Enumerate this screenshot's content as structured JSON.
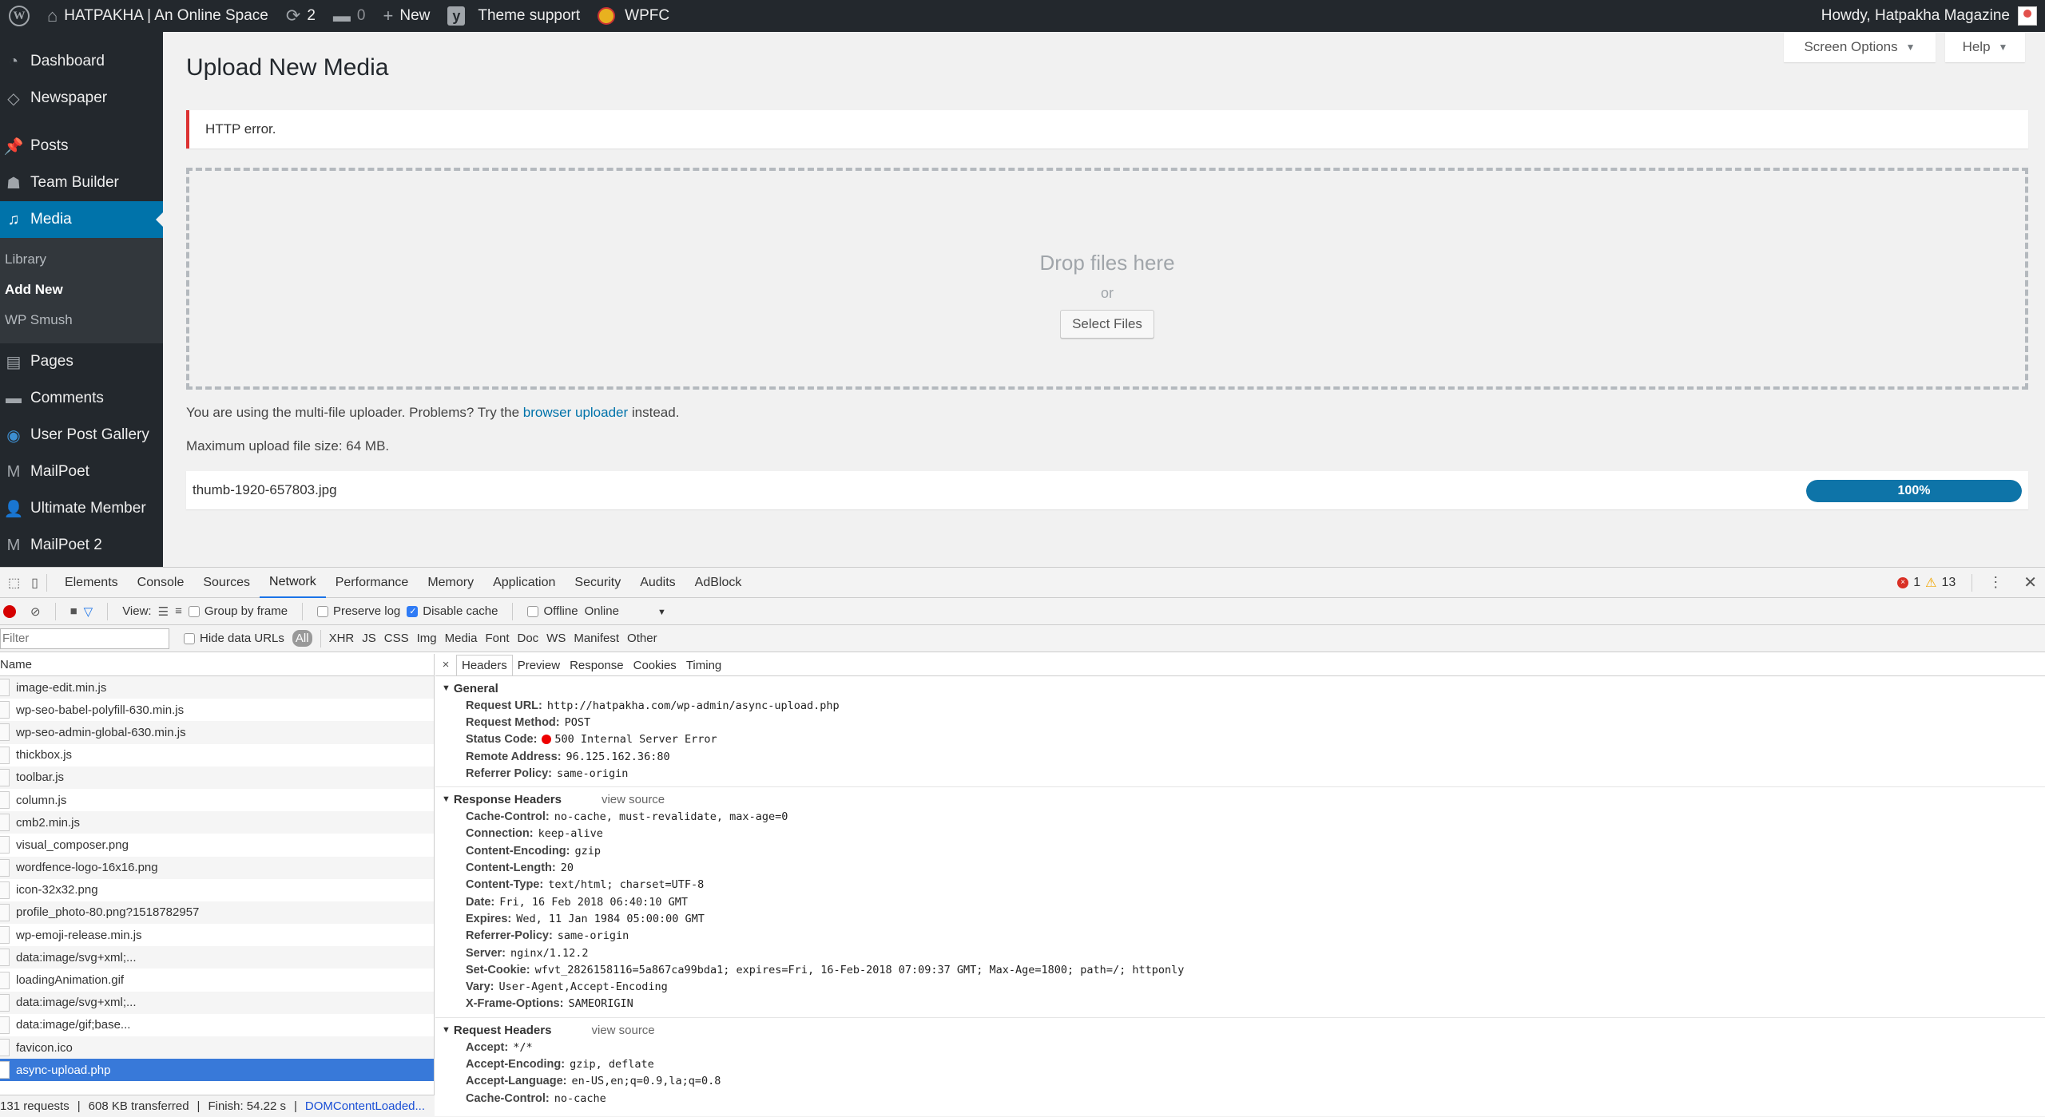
{
  "adminbar": {
    "site_name": "HATPAKHA | An Online Space",
    "updates_count": "2",
    "comments_count": "0",
    "new_label": "New",
    "theme_support": "Theme support",
    "wpfc": "WPFC",
    "howdy": "Howdy, Hatpakha Magazine"
  },
  "sidebar": {
    "items": [
      {
        "label": "Dashboard",
        "icon": "dashboard-icon"
      },
      {
        "label": "Newspaper",
        "icon": "newspaper-icon"
      },
      {
        "label": "Posts",
        "icon": "pin-icon"
      },
      {
        "label": "Team Builder",
        "icon": "team-icon"
      },
      {
        "label": "Media",
        "icon": "media-icon"
      },
      {
        "label": "Pages",
        "icon": "pages-icon"
      },
      {
        "label": "Comments",
        "icon": "comment-icon"
      },
      {
        "label": "User Post Gallery",
        "icon": "camera-icon"
      },
      {
        "label": "MailPoet",
        "icon": "mailpoet-icon"
      },
      {
        "label": "Ultimate Member",
        "icon": "user-icon"
      },
      {
        "label": "MailPoet 2",
        "icon": "mailpoet-icon"
      }
    ],
    "media_submenu": [
      "Library",
      "Add New",
      "WP Smush"
    ]
  },
  "main": {
    "title": "Upload New Media",
    "screen_options": "Screen Options",
    "help": "Help",
    "error_notice": "HTTP error.",
    "drop_title": "Drop files here",
    "drop_or": "or",
    "select_files": "Select Files",
    "uploader_text_pre": "You are using the multi-file uploader. Problems? Try the",
    "uploader_link": "browser uploader",
    "uploader_text_post": "instead.",
    "max_size": "Maximum upload file size: 64 MB.",
    "upload_item": {
      "filename": "thumb-1920-657803.jpg",
      "progress_label": "100%",
      "progress_fraction": 1.0
    }
  },
  "devtools": {
    "tabs": [
      "Elements",
      "Console",
      "Sources",
      "Network",
      "Performance",
      "Memory",
      "Application",
      "Security",
      "Audits",
      "AdBlock"
    ],
    "active_tab": "Network",
    "error_count": "1",
    "warning_count": "13",
    "toolbar": {
      "view_label": "View:",
      "group_by_frame": "Group by frame",
      "preserve_log": "Preserve log",
      "disable_cache": "Disable cache",
      "offline": "Offline",
      "throttle": "Online"
    },
    "filter": {
      "placeholder": "Filter",
      "hide_data_urls": "Hide data URLs",
      "types": [
        "All",
        "XHR",
        "JS",
        "CSS",
        "Img",
        "Media",
        "Font",
        "Doc",
        "WS",
        "Manifest",
        "Other"
      ]
    },
    "name_header": "Name",
    "requests": [
      "image-edit.min.js",
      "wp-seo-babel-polyfill-630.min.js",
      "wp-seo-admin-global-630.min.js",
      "thickbox.js",
      "toolbar.js",
      "column.js",
      "cmb2.min.js",
      "visual_composer.png",
      "wordfence-logo-16x16.png",
      "icon-32x32.png",
      "profile_photo-80.png?1518782957",
      "wp-emoji-release.min.js",
      "data:image/svg+xml;...",
      "loadingAnimation.gif",
      "data:image/svg+xml;...",
      "data:image/gif;base...",
      "favicon.ico",
      "async-upload.php"
    ],
    "selected_request": "async-upload.php",
    "summary": {
      "requests": "131 requests",
      "transferred": "608 KB transferred",
      "finish": "Finish: 54.22 s",
      "dcl": "DOMContentLoaded..."
    },
    "detail_tabs": [
      "Headers",
      "Preview",
      "Response",
      "Cookies",
      "Timing"
    ],
    "general": {
      "title": "General",
      "rows": [
        {
          "k": "Request URL:",
          "v": "http://hatpakha.com/wp-admin/async-upload.php"
        },
        {
          "k": "Request Method:",
          "v": "POST"
        },
        {
          "k": "Status Code:",
          "v": "500 Internal Server Error"
        },
        {
          "k": "Remote Address:",
          "v": "96.125.162.36:80"
        },
        {
          "k": "Referrer Policy:",
          "v": "same-origin"
        }
      ]
    },
    "response_headers": {
      "title": "Response Headers",
      "view_source": "view source",
      "rows": [
        {
          "k": "Cache-Control:",
          "v": "no-cache, must-revalidate, max-age=0"
        },
        {
          "k": "Connection:",
          "v": "keep-alive"
        },
        {
          "k": "Content-Encoding:",
          "v": "gzip"
        },
        {
          "k": "Content-Length:",
          "v": "20"
        },
        {
          "k": "Content-Type:",
          "v": "text/html; charset=UTF-8"
        },
        {
          "k": "Date:",
          "v": "Fri, 16 Feb 2018 06:40:10 GMT"
        },
        {
          "k": "Expires:",
          "v": "Wed, 11 Jan 1984 05:00:00 GMT"
        },
        {
          "k": "Referrer-Policy:",
          "v": "same-origin"
        },
        {
          "k": "Server:",
          "v": "nginx/1.12.2"
        },
        {
          "k": "Set-Cookie:",
          "v": "wfvt_2826158116=5a867ca99bda1; expires=Fri, 16-Feb-2018 07:09:37 GMT; Max-Age=1800; path=/; httponly"
        },
        {
          "k": "Vary:",
          "v": "User-Agent,Accept-Encoding"
        },
        {
          "k": "X-Frame-Options:",
          "v": "SAMEORIGIN"
        }
      ]
    },
    "request_headers": {
      "title": "Request Headers",
      "view_source": "view source",
      "rows": [
        {
          "k": "Accept:",
          "v": "*/*"
        },
        {
          "k": "Accept-Encoding:",
          "v": "gzip, deflate"
        },
        {
          "k": "Accept-Language:",
          "v": "en-US,en;q=0.9,la;q=0.8"
        },
        {
          "k": "Cache-Control:",
          "v": "no-cache"
        }
      ]
    }
  },
  "colors": {
    "admin_dark": "#23282d",
    "wp_blue": "#0073aa",
    "error_red": "#dc3232",
    "selected_row": "#3879d9"
  }
}
